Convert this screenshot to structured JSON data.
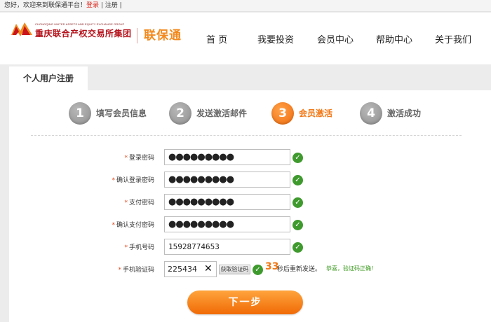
{
  "topbar": {
    "welcome": "您好，欢迎来到联保通平台！",
    "login": "登录",
    "sep1": " | ",
    "register": "注册",
    "sep2": " |"
  },
  "header": {
    "logo_en": "CHONGQING UNITED ASSETS AND EQUITY EXCHANGE GROUP",
    "logo_cn": "重庆联合产权交易所集团",
    "brand": "联保通",
    "nav": [
      "首 页",
      "我要投资",
      "会员中心",
      "帮助中心",
      "关于我们"
    ]
  },
  "tab": {
    "title": "个人用户注册"
  },
  "steps": [
    {
      "num": "1",
      "label": "填写会员信息"
    },
    {
      "num": "2",
      "label": "发送激活邮件"
    },
    {
      "num": "3",
      "label": "会员激活"
    },
    {
      "num": "4",
      "label": "激活成功"
    }
  ],
  "form": {
    "star": "*",
    "fields": [
      {
        "label": "登录密码",
        "value": "●●●●●●●●●"
      },
      {
        "label": "确认登录密码",
        "value": "●●●●●●●●●"
      },
      {
        "label": "支付密码",
        "value": "●●●●●●●●●"
      },
      {
        "label": "确认支付密码",
        "value": "●●●●●●●●●"
      },
      {
        "label": "手机号码",
        "value": "15928774653"
      }
    ],
    "code": {
      "label": "手机验证码",
      "value": "225434",
      "clear": "✕",
      "get_button": "获取验证码",
      "countdown": "33",
      "resend_text": "秒后重新发送。",
      "ok_text": "恭喜，验证码正确！"
    },
    "check_glyph": "✓",
    "next_button": "下一步"
  },
  "colors": {
    "accent": "#f27816",
    "brand_red": "#b5111a",
    "ok_green": "#3f9a2e"
  }
}
